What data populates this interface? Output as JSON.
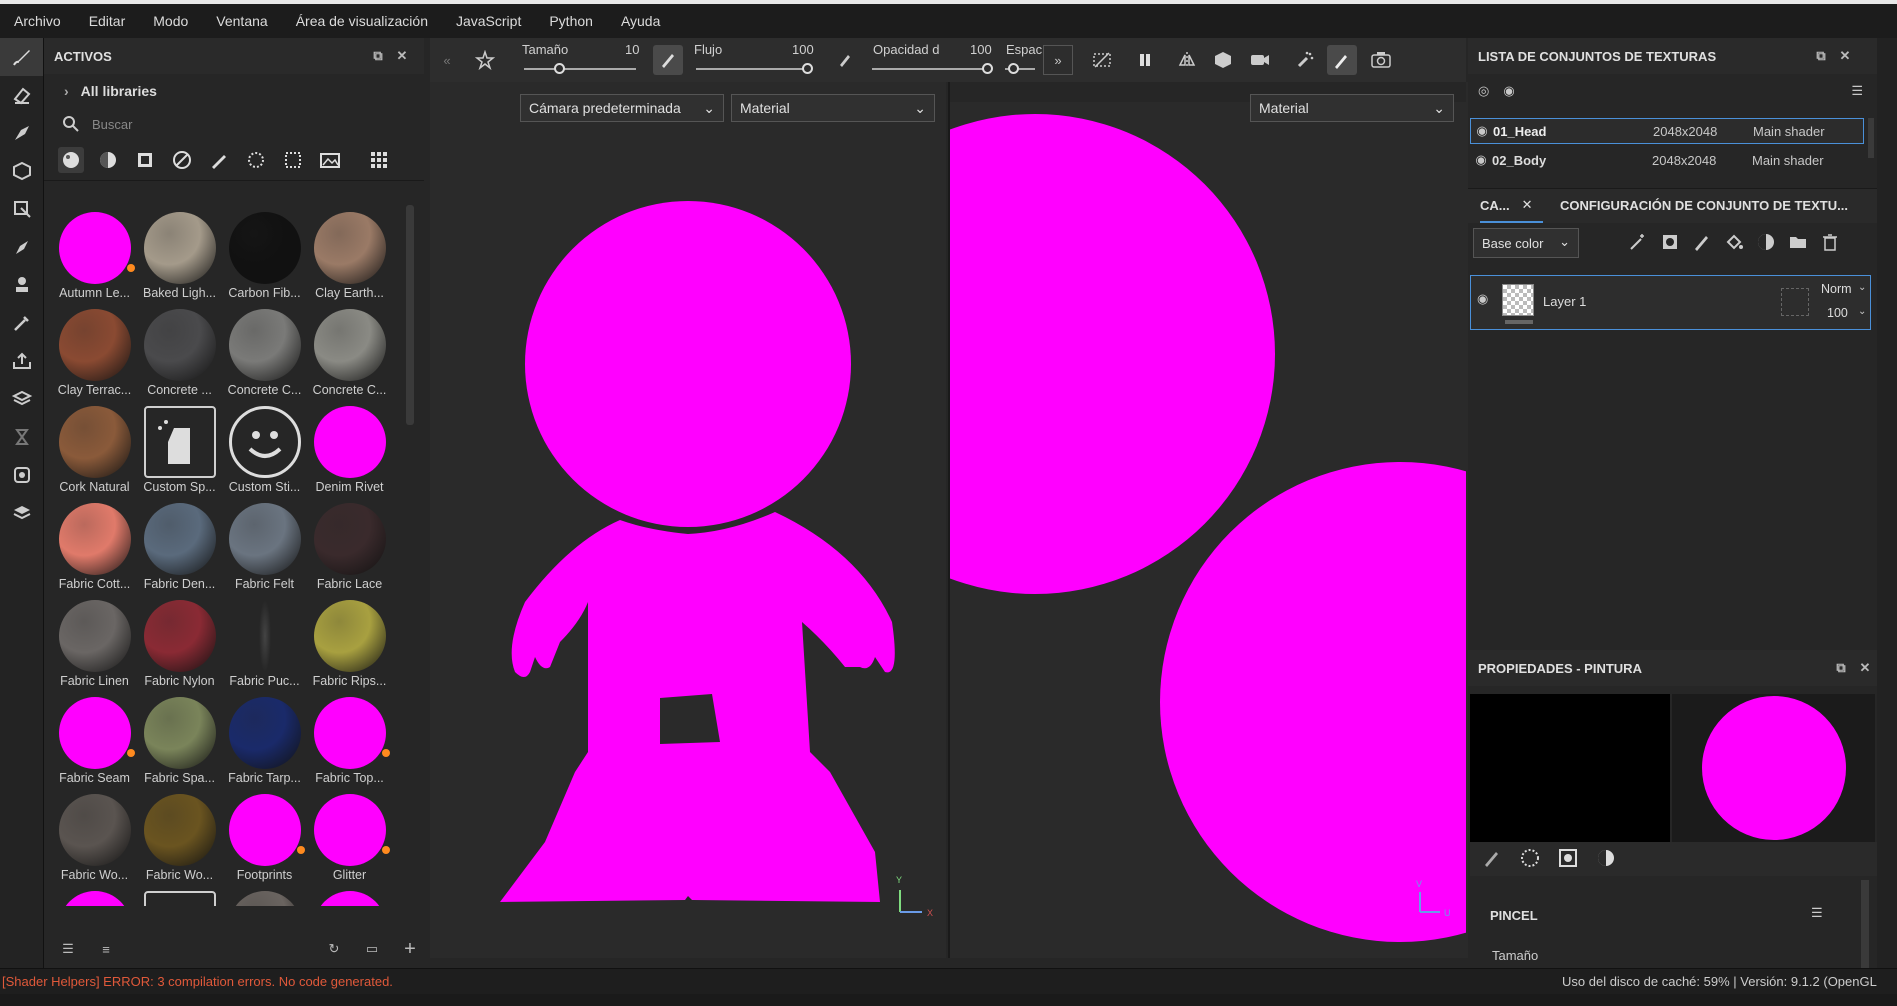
{
  "menu": [
    "Archivo",
    "Editar",
    "Modo",
    "Ventana",
    "Área de visualización",
    "JavaScript",
    "Python",
    "Ayuda"
  ],
  "tools": [
    "brush-icon",
    "eraser-icon",
    "projection-icon",
    "polyfill-icon",
    "smudge-icon",
    "clone-icon",
    "picker-icon",
    "color-picker-icon",
    "export-icon",
    "bake-icon",
    "hourglass-icon",
    "render-icon",
    "unwrap-icon"
  ],
  "assets": {
    "title": "ACTIVOS",
    "libraries": "All libraries",
    "search_placeholder": "Buscar",
    "items": [
      {
        "label": "Autumn Le...",
        "color": "#ff00ff",
        "badge": true
      },
      {
        "label": "Baked Ligh...",
        "color": "#a49a8a"
      },
      {
        "label": "Carbon Fib...",
        "color": "#111111"
      },
      {
        "label": "Clay Earth...",
        "color": "#9a7a66"
      },
      {
        "label": "Clay Terrac...",
        "color": "#8a4a32"
      },
      {
        "label": "Concrete ...",
        "color": "#4a4a4c"
      },
      {
        "label": "Concrete C...",
        "color": "#7a7a78"
      },
      {
        "label": "Concrete C...",
        "color": "#8a8a84"
      },
      {
        "label": "Cork Natural",
        "color": "#8a5a3a"
      },
      {
        "label": "Custom Sp...",
        "icon": "spray"
      },
      {
        "label": "Custom Sti...",
        "icon": "sticker"
      },
      {
        "label": "Denim Rivet",
        "color": "#ff00ff"
      },
      {
        "label": "Fabric Cott...",
        "color": "#e07a6a"
      },
      {
        "label": "Fabric Den...",
        "color": "#5a6a7c"
      },
      {
        "label": "Fabric Felt",
        "color": "#6a7480"
      },
      {
        "label": "Fabric Lace",
        "color": "#3a2a2c"
      },
      {
        "label": "Fabric Linen",
        "color": "#6a6664"
      },
      {
        "label": "Fabric Nylon",
        "color": "#8a2a34"
      },
      {
        "label": "Fabric Puc...",
        "color": "#2a2a2a",
        "thin": true
      },
      {
        "label": "Fabric Rips...",
        "color": "#a8a040"
      },
      {
        "label": "Fabric Seam",
        "color": "#ff00ff",
        "badge": true
      },
      {
        "label": "Fabric Spa...",
        "color": "#7a845a"
      },
      {
        "label": "Fabric Tarp...",
        "color": "#1a2a6a"
      },
      {
        "label": "Fabric Top...",
        "color": "#ff00ff",
        "badge": true
      },
      {
        "label": "Fabric Wo...",
        "color": "#5a5450"
      },
      {
        "label": "Fabric Wo...",
        "color": "#6a5420"
      },
      {
        "label": "Footprints",
        "color": "#ff00ff",
        "badge": true
      },
      {
        "label": "Glitter",
        "color": "#ff00ff",
        "badge": true
      },
      {
        "label": "",
        "color": "#ff00ff"
      },
      {
        "label": "",
        "icon": "square"
      },
      {
        "label": "",
        "color": "#6a6460"
      },
      {
        "label": "",
        "color": "#ff00ff"
      }
    ]
  },
  "toolbar": {
    "size_label": "Tamaño",
    "size_value": "10",
    "flow_label": "Flujo",
    "flow_value": "100",
    "opacity_label": "Opacidad d",
    "opacity_value": "100",
    "spacing_label": "Espac"
  },
  "viewport3d": {
    "camera": "Cámara predeterminada",
    "mode": "Material",
    "axis_x": "X",
    "axis_y": "Y"
  },
  "viewport2d": {
    "mode": "Material",
    "axis_u": "U",
    "axis_v": "V"
  },
  "texture_sets": {
    "title": "LISTA DE CONJUNTOS DE TEXTURAS",
    "rows": [
      {
        "name": "01_Head",
        "res": "2048x2048",
        "shader": "Main shader"
      },
      {
        "name": "02_Body",
        "res": "2048x2048",
        "shader": "Main shader"
      }
    ]
  },
  "layers": {
    "tab1": "CA...",
    "tab2": "CONFIGURACIÓN DE CONJUNTO DE TEXTU...",
    "channel": "Base color",
    "layer_name": "Layer 1",
    "blend": "Norm",
    "opacity": "100"
  },
  "properties": {
    "title": "PROPIEDADES - PINTURA",
    "section": "PINCEL",
    "first_prop": "Tamaño"
  },
  "status": {
    "error": "[Shader Helpers] ERROR: 3 compilation errors. No code generated.",
    "info": "Uso del disco de caché:  59% | Versión: 9.1.2 (OpenGL"
  },
  "colors": {
    "magenta": "#ff00ff",
    "accent": "#4a90d9",
    "error": "#e0593a"
  }
}
